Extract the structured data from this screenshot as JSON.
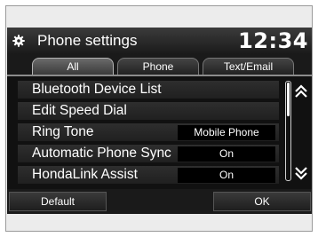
{
  "header": {
    "title": "Phone settings",
    "clock": "12:34",
    "icon": "gear-icon"
  },
  "tabs": [
    {
      "label": "All",
      "active": true
    },
    {
      "label": "Phone",
      "active": false
    },
    {
      "label": "Text/Email",
      "active": false
    }
  ],
  "list": {
    "items": [
      {
        "label": "Bluetooth Device List",
        "value": ""
      },
      {
        "label": "Edit Speed Dial",
        "value": ""
      },
      {
        "label": "Ring Tone",
        "value": "Mobile Phone"
      },
      {
        "label": "Automatic Phone Sync",
        "value": "On"
      },
      {
        "label": "HondaLink Assist",
        "value": "On"
      }
    ],
    "scroll_up_icon": "double-chevron-up-icon",
    "scroll_down_icon": "double-chevron-down-icon"
  },
  "footer": {
    "default_label": "Default",
    "ok_label": "OK"
  }
}
